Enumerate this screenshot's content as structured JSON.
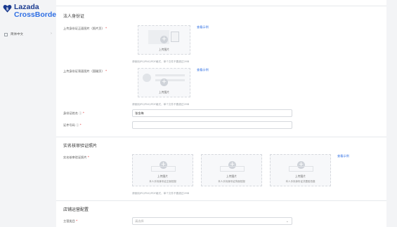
{
  "sidebar": {
    "brand": "Lazada",
    "sub_brand": "CrossBorder",
    "lang_label": "简体中文",
    "lang_chevron": "›"
  },
  "legal_id": {
    "section_title": "法人身份证",
    "front_label": "上传身份证正面图片（照片页）",
    "front_example": "查看示例",
    "front_upload_text": "上传图片",
    "front_hint": "请使用JPG/PNG/PDF格式，单个文件不要超过2MB",
    "back_label": "上传身份证背面图片（国徽页）",
    "back_example": "查看示例",
    "back_upload_text": "上传图片",
    "back_hint": "请使用JPG/PNG/PDF格式，单个文件不要超过2MB",
    "name_label": "身份证姓名 ⓘ",
    "name_value": "张金梅",
    "number_label": "证件号码 ⓘ",
    "number_value": ""
  },
  "verification": {
    "section_title": "实名核审验证照片",
    "photo_label": "实名核审验证照片",
    "example": "查看示例",
    "uploads": [
      {
        "text": "上传图片",
        "sub": "本人手持身份证正面拍摄"
      },
      {
        "text": "上传图片",
        "sub": "本人手持身份证背面拍摄"
      },
      {
        "text": "上传图片",
        "sub": "本人手持身份证并露脸拍摄"
      }
    ],
    "hint": "请使用JPG/PNG/PDF格式，单个文件不要超过2MB"
  },
  "store_config": {
    "section_title": "店铺运营配置",
    "category_label": "主营类目",
    "category_placeholder": "请选择",
    "category_chevron": "⌄"
  },
  "colors": {
    "brand_navy": "#1a3a8f",
    "brand_blue": "#2f6fe4",
    "required_red": "#e4393c"
  }
}
